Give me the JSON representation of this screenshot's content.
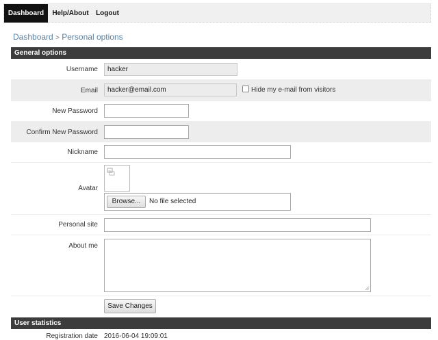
{
  "nav": {
    "dashboard": "Dashboard",
    "help": "Help/About",
    "logout": "Logout"
  },
  "breadcrumb": {
    "root": "Dashboard",
    "separator": ">",
    "current": "Personal options"
  },
  "general": {
    "header": "General options",
    "username_label": "Username",
    "username_value": "hacker",
    "email_label": "Email",
    "email_value": "hacker@email.com",
    "hide_email_label": "Hide my e-mail from visitors",
    "new_password_label": "New Password",
    "confirm_password_label": "Confirm New Password",
    "nickname_label": "Nickname",
    "avatar_label": "Avatar",
    "browse_label": "Browse...",
    "file_status": "No file selected",
    "personal_site_label": "Personal site",
    "about_me_label": "About me",
    "save_label": "Save Changes"
  },
  "stats": {
    "header": "User statistics",
    "registration_label": "Registration date",
    "registration_value": "2016-06-04 19:09:01"
  }
}
